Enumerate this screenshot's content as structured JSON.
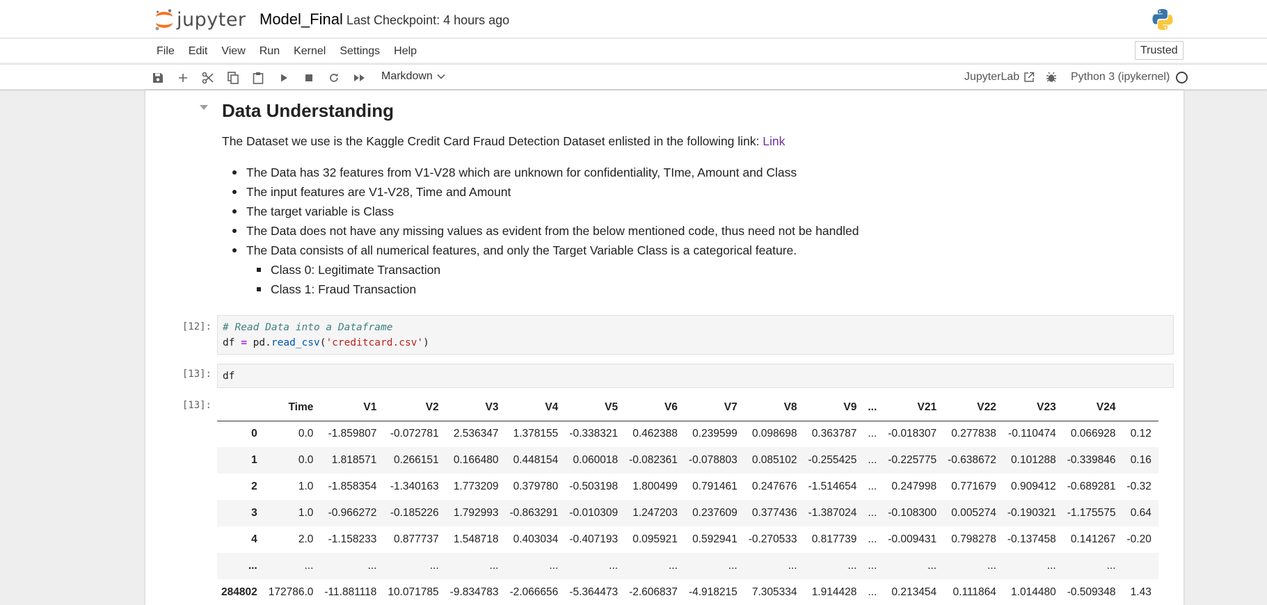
{
  "header": {
    "logo_text": "jupyter",
    "notebook_title": "Model_Final",
    "checkpoint": "Last Checkpoint: 4 hours ago"
  },
  "menu": {
    "items": [
      "File",
      "Edit",
      "View",
      "Run",
      "Kernel",
      "Settings",
      "Help"
    ],
    "trusted": "Trusted"
  },
  "toolbar": {
    "cell_type": "Markdown",
    "jupyterlab_link": "JupyterLab",
    "kernel_name": "Python 3 (ipykernel)"
  },
  "markdown": {
    "heading": "Data Understanding",
    "intro_text": "The Dataset we use is the Kaggle Credit Card Fraud Detection Dataset enlisted in the following link: ",
    "intro_link": "Link",
    "bullets": [
      "The Data has 32 features from V1-V28 which are unknown for confidentiality, TIme, Amount and Class",
      "The input features are V1-V28, Time and Amount",
      "The target variable is Class",
      "The Data does not have any missing values as evident from the below mentioned code, thus need not be handled",
      "The Data consists of all numerical features, and only the Target Variable Class is a categorical feature."
    ],
    "sub_bullets": [
      "Class 0: Legitimate Transaction",
      "Class 1: Fraud Transaction"
    ]
  },
  "cells": {
    "cell12_prompt": "[12]:",
    "cell12_comment": "# Read Data into a Dataframe",
    "cell12_var": "df",
    "cell12_eq": "=",
    "cell12_obj": "pd.",
    "cell12_fn": "read_csv",
    "cell12_open": "(",
    "cell12_str": "'creditcard.csv'",
    "cell12_close": ")",
    "cell13_prompt": "[13]:",
    "cell13_code": "df",
    "out13_prompt": "[13]:"
  },
  "dataframe": {
    "columns": [
      "",
      "Time",
      "V1",
      "V2",
      "V3",
      "V4",
      "V5",
      "V6",
      "V7",
      "V8",
      "V9",
      "...",
      "V21",
      "V22",
      "V23",
      "V24",
      ""
    ],
    "rows": [
      [
        "0",
        "0.0",
        "-1.859807",
        "-0.072781",
        "2.536347",
        "1.378155",
        "-0.338321",
        "0.462388",
        "0.239599",
        "0.098698",
        "0.363787",
        "...",
        "-0.018307",
        "0.277838",
        "-0.110474",
        "0.066928",
        "0.12"
      ],
      [
        "1",
        "0.0",
        "1.818571",
        "0.266151",
        "0.166480",
        "0.448154",
        "0.060018",
        "-0.082361",
        "-0.078803",
        "0.085102",
        "-0.255425",
        "...",
        "-0.225775",
        "-0.638672",
        "0.101288",
        "-0.339846",
        "0.16"
      ],
      [
        "2",
        "1.0",
        "-1.858354",
        "-1.340163",
        "1.773209",
        "0.379780",
        "-0.503198",
        "1.800499",
        "0.791461",
        "0.247676",
        "-1.514654",
        "...",
        "0.247998",
        "0.771679",
        "0.909412",
        "-0.689281",
        "-0.32"
      ],
      [
        "3",
        "1.0",
        "-0.966272",
        "-0.185226",
        "1.792993",
        "-0.863291",
        "-0.010309",
        "1.247203",
        "0.237609",
        "0.377436",
        "-1.387024",
        "...",
        "-0.108300",
        "0.005274",
        "-0.190321",
        "-1.175575",
        "0.64"
      ],
      [
        "4",
        "2.0",
        "-1.158233",
        "0.877737",
        "1.548718",
        "0.403034",
        "-0.407193",
        "0.095921",
        "0.592941",
        "-0.270533",
        "0.817739",
        "...",
        "-0.009431",
        "0.798278",
        "-0.137458",
        "0.141267",
        "-0.20"
      ],
      [
        "...",
        "...",
        "...",
        "...",
        "...",
        "...",
        "...",
        "...",
        "...",
        "...",
        "...",
        "...",
        "...",
        "...",
        "...",
        "...",
        ""
      ],
      [
        "284802",
        "172786.0",
        "-11.881118",
        "10.071785",
        "-9.834783",
        "-2.066656",
        "-5.364473",
        "-2.606837",
        "-4.918215",
        "7.305334",
        "1.914428",
        "...",
        "0.213454",
        "0.111864",
        "1.014480",
        "-0.509348",
        "1.43"
      ]
    ]
  }
}
